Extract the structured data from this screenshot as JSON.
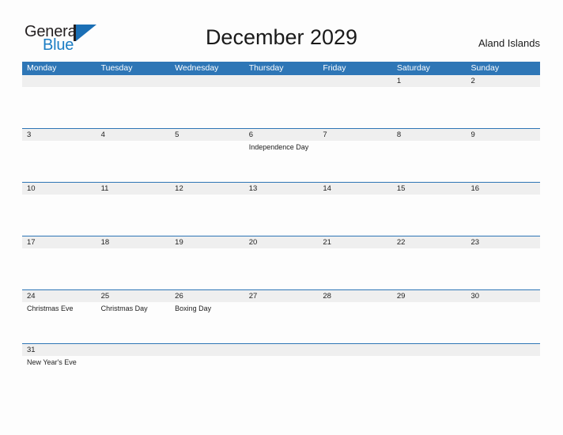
{
  "brand": {
    "name_part1": "General",
    "name_part2": "Blue"
  },
  "header": {
    "title": "December 2029",
    "country": "Aland Islands"
  },
  "calendar": {
    "weekdays": [
      "Monday",
      "Tuesday",
      "Wednesday",
      "Thursday",
      "Friday",
      "Saturday",
      "Sunday"
    ],
    "weeks": [
      {
        "days": [
          {
            "num": "",
            "events": []
          },
          {
            "num": "",
            "events": []
          },
          {
            "num": "",
            "events": []
          },
          {
            "num": "",
            "events": []
          },
          {
            "num": "",
            "events": []
          },
          {
            "num": "1",
            "events": []
          },
          {
            "num": "2",
            "events": []
          }
        ]
      },
      {
        "days": [
          {
            "num": "3",
            "events": []
          },
          {
            "num": "4",
            "events": []
          },
          {
            "num": "5",
            "events": []
          },
          {
            "num": "6",
            "events": [
              "Independence Day"
            ]
          },
          {
            "num": "7",
            "events": []
          },
          {
            "num": "8",
            "events": []
          },
          {
            "num": "9",
            "events": []
          }
        ]
      },
      {
        "days": [
          {
            "num": "10",
            "events": []
          },
          {
            "num": "11",
            "events": []
          },
          {
            "num": "12",
            "events": []
          },
          {
            "num": "13",
            "events": []
          },
          {
            "num": "14",
            "events": []
          },
          {
            "num": "15",
            "events": []
          },
          {
            "num": "16",
            "events": []
          }
        ]
      },
      {
        "days": [
          {
            "num": "17",
            "events": []
          },
          {
            "num": "18",
            "events": []
          },
          {
            "num": "19",
            "events": []
          },
          {
            "num": "20",
            "events": []
          },
          {
            "num": "21",
            "events": []
          },
          {
            "num": "22",
            "events": []
          },
          {
            "num": "23",
            "events": []
          }
        ]
      },
      {
        "days": [
          {
            "num": "24",
            "events": [
              "Christmas Eve"
            ]
          },
          {
            "num": "25",
            "events": [
              "Christmas Day"
            ]
          },
          {
            "num": "26",
            "events": [
              "Boxing Day"
            ]
          },
          {
            "num": "27",
            "events": []
          },
          {
            "num": "28",
            "events": []
          },
          {
            "num": "29",
            "events": []
          },
          {
            "num": "30",
            "events": []
          }
        ]
      },
      {
        "days": [
          {
            "num": "31",
            "events": [
              "New Year's Eve"
            ]
          },
          {
            "num": "",
            "events": []
          },
          {
            "num": "",
            "events": []
          },
          {
            "num": "",
            "events": []
          },
          {
            "num": "",
            "events": []
          },
          {
            "num": "",
            "events": []
          },
          {
            "num": "",
            "events": []
          }
        ]
      }
    ]
  },
  "colors": {
    "header_blue": "#2e76b6",
    "brand_blue": "#1b7dc4",
    "number_band": "#efefef",
    "cell_bg": "#fdfdfd"
  }
}
